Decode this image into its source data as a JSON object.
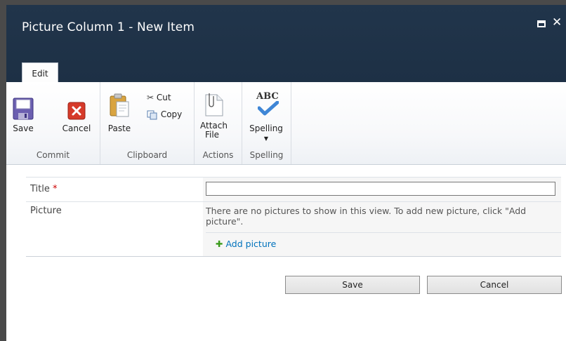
{
  "dialog": {
    "title": "Picture Column 1 - New Item"
  },
  "ribbon": {
    "tabs": [
      {
        "label": "Edit",
        "selected": true
      }
    ],
    "groups": {
      "commit": {
        "label": "Commit",
        "save": "Save",
        "cancel": "Cancel"
      },
      "clipboard": {
        "label": "Clipboard",
        "paste": "Paste",
        "cut": "Cut",
        "copy": "Copy"
      },
      "actions": {
        "label": "Actions",
        "attach_line1": "Attach",
        "attach_line2": "File"
      },
      "spelling": {
        "label": "Spelling",
        "spelling": "Spelling",
        "abc": "ABC"
      }
    }
  },
  "form": {
    "fields": [
      {
        "label": "Title",
        "required_marker": "*",
        "value": ""
      },
      {
        "label": "Picture",
        "message": "There are no pictures to show in this view. To add new picture, click \"Add picture\".",
        "add_link": "Add picture"
      }
    ],
    "save_button": "Save",
    "cancel_button": "Cancel"
  },
  "colors": {
    "titlebar": "#1f3247",
    "required": "#cc0000",
    "link": "#0072bc",
    "add_icon": "#3a9a1a"
  },
  "icons": [
    "save-icon",
    "cancel-icon",
    "paste-icon",
    "cut-icon",
    "copy-icon",
    "attach-file-icon",
    "spelling-icon",
    "add-icon",
    "maximize-icon",
    "close-icon"
  ]
}
